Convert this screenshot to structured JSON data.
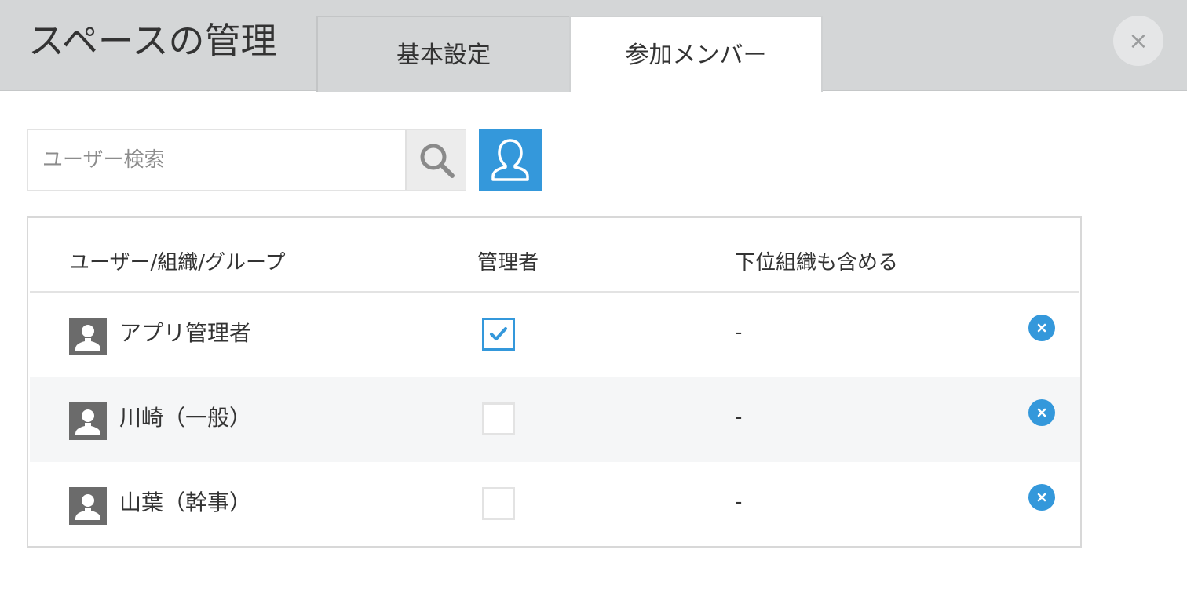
{
  "dialog": {
    "title": "スペースの管理",
    "close_label": "×"
  },
  "tabs": [
    {
      "label": "基本設定",
      "active": false
    },
    {
      "label": "参加メンバー",
      "active": true
    }
  ],
  "search": {
    "placeholder": "ユーザー検索",
    "value": "",
    "search_icon": "search-icon",
    "picker_icon": "user-icon"
  },
  "table": {
    "headers": {
      "entity": "ユーザー/組織/グループ",
      "admin": "管理者",
      "include_sub": "下位組織も含める"
    },
    "rows": [
      {
        "name": "アプリ管理者",
        "admin": true,
        "include_sub": "-"
      },
      {
        "name": "川崎（一般）",
        "admin": false,
        "include_sub": "-"
      },
      {
        "name": "山葉（幹事）",
        "admin": false,
        "include_sub": "-"
      }
    ]
  },
  "colors": {
    "accent": "#3498db",
    "header_bg": "#d4d6d7",
    "alt_row_bg": "#f5f6f7"
  }
}
